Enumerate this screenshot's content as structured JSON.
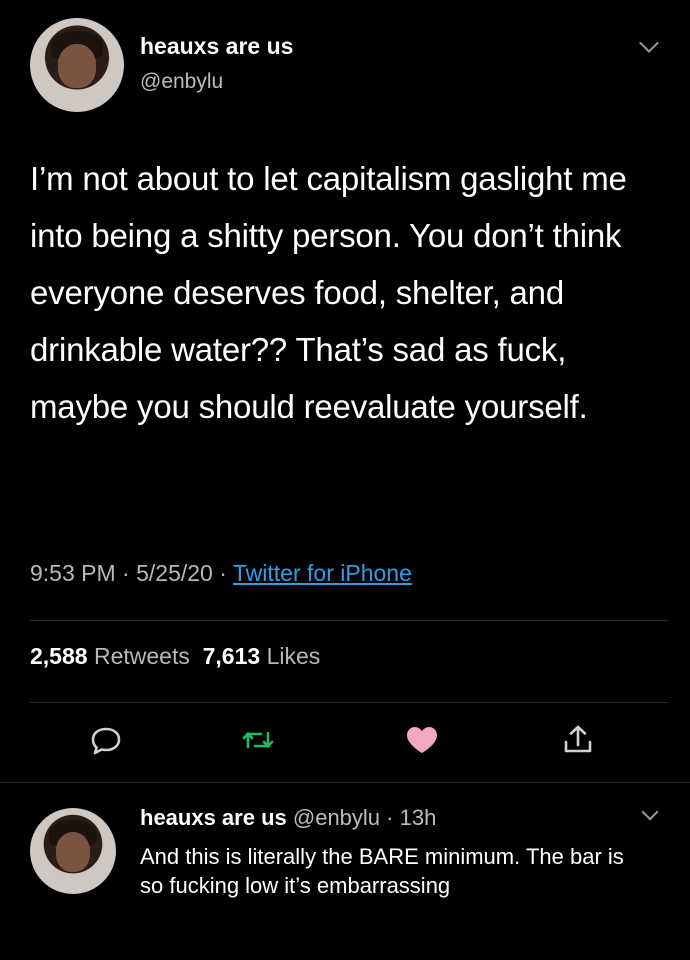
{
  "tweet": {
    "display_name": "heauxs are us",
    "handle": "@enbylu",
    "text": "I’m not about to let capitalism gaslight me into being a shitty person. You don’t think everyone deserves food, shelter, and drinkable water?? That’s sad as fuck, maybe you should reevaluate yourself.",
    "time": "9:53 PM",
    "sep1": " · ",
    "date": "5/25/20",
    "sep2": " · ",
    "source": "Twitter for iPhone",
    "retweets_count": "2,588",
    "retweets_label": "Retweets",
    "likes_count": "7,613",
    "likes_label": "Likes",
    "icons": [
      "reply-icon",
      "retweet-icon",
      "like-icon",
      "share-icon"
    ],
    "like_color": "#f2a7c3",
    "retweet_color": "#17bf63"
  },
  "reply": {
    "display_name": "heauxs are us",
    "handle": "@enbylu",
    "age": "13h",
    "sep": " · ",
    "text": "And this is literally the BARE minimum. The bar is so fucking low it’s embarrassing"
  },
  "colors": {
    "background": "#000000",
    "link": "#2f9fe6",
    "secondary_text": "#b8b8b8"
  }
}
